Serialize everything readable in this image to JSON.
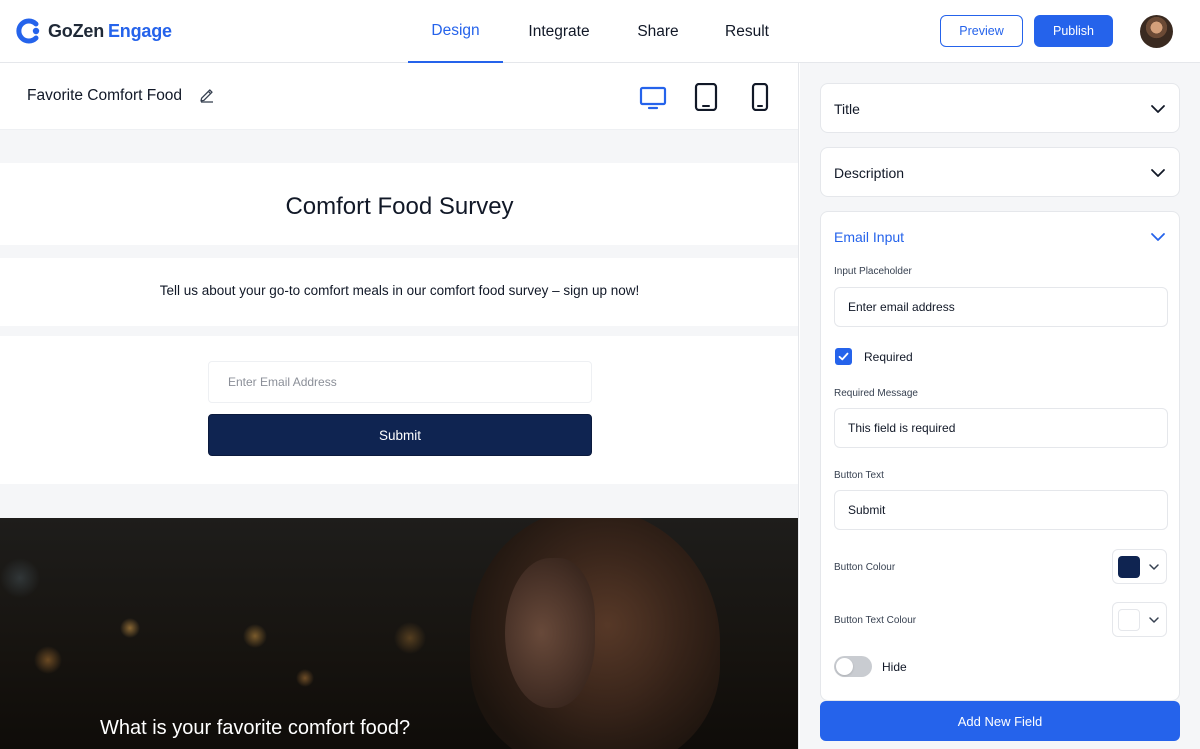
{
  "brand": {
    "name_part1": "GoZen",
    "name_part2": "Engage"
  },
  "nav": {
    "tabs": [
      {
        "label": "Design",
        "active": true
      },
      {
        "label": "Integrate",
        "active": false
      },
      {
        "label": "Share",
        "active": false
      },
      {
        "label": "Result",
        "active": false
      }
    ]
  },
  "toolbar": {
    "preview_label": "Preview",
    "publish_label": "Publish"
  },
  "form_header": {
    "name": "Favorite Comfort Food",
    "devices": [
      "desktop-icon",
      "tablet-icon",
      "mobile-icon"
    ],
    "active_device": "desktop"
  },
  "preview": {
    "title": "Comfort Food Survey",
    "description": "Tell us about your go-to comfort meals in our comfort food survey – sign up now!",
    "email_placeholder": "Enter Email Address",
    "submit_label": "Submit",
    "next_question": "What is your favorite comfort food?"
  },
  "settings": {
    "sections": {
      "title": "Title",
      "description": "Description",
      "email_input": "Email Input"
    },
    "input_placeholder_label": "Input Placeholder",
    "input_placeholder_value": "Enter email address",
    "required_checked": true,
    "required_label": "Required",
    "required_message_label": "Required Message",
    "required_message_value": "This field is required",
    "button_text_label": "Button Text",
    "button_text_value": "Submit",
    "button_colour_label": "Button Colour",
    "button_colour": "#0f2451",
    "button_text_colour_label": "Button Text Colour",
    "button_text_colour": "#ffffff",
    "hide_label": "Hide",
    "hide_on": false,
    "add_field_label": "Add New Field"
  },
  "colors": {
    "accent": "#2563eb",
    "dark_button": "#0f2451"
  }
}
